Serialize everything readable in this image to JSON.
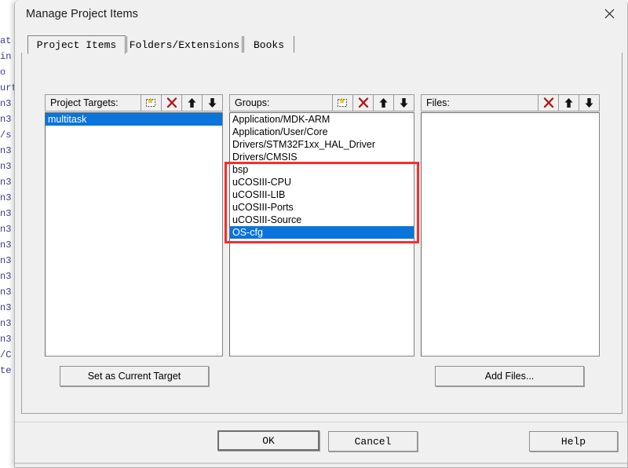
{
  "background": {
    "code_fragment": "at\nin\no\nurt\nn3\nn3\n/s\nn3\nn3\nn3\nn3\nn3\nn3\nn3\nn3\nn3\nn3\nn3\nn3\nn3\n/C\nte"
  },
  "dialog": {
    "title": "Manage Project Items",
    "close_icon": "close-icon"
  },
  "tabs": [
    {
      "label": "Project Items",
      "active": true
    },
    {
      "label": "Folders/Extensions",
      "active": false
    },
    {
      "label": "Books",
      "active": false
    }
  ],
  "columns": {
    "targets": {
      "header": "Project Targets:",
      "buttons": [
        {
          "name": "new-item-button",
          "icon": "new-item-icon"
        },
        {
          "name": "delete-button",
          "icon": "red-x-icon"
        },
        {
          "name": "move-up-button",
          "icon": "arrow-up-icon"
        },
        {
          "name": "move-down-button",
          "icon": "arrow-down-icon"
        }
      ],
      "items": [
        {
          "label": "multitask",
          "selected": true
        }
      ]
    },
    "groups": {
      "header": "Groups:",
      "buttons": [
        {
          "name": "new-item-button",
          "icon": "new-item-icon"
        },
        {
          "name": "delete-button",
          "icon": "red-x-icon"
        },
        {
          "name": "move-up-button",
          "icon": "arrow-up-icon"
        },
        {
          "name": "move-down-button",
          "icon": "arrow-down-icon"
        }
      ],
      "items": [
        {
          "label": "Application/MDK-ARM",
          "selected": false
        },
        {
          "label": "Application/User/Core",
          "selected": false
        },
        {
          "label": "Drivers/STM32F1xx_HAL_Driver",
          "selected": false
        },
        {
          "label": "Drivers/CMSIS",
          "selected": false
        },
        {
          "label": "bsp",
          "selected": false
        },
        {
          "label": "uCOSIII-CPU",
          "selected": false
        },
        {
          "label": "uCOSIII-LIB",
          "selected": false
        },
        {
          "label": "uCOSIII-Ports",
          "selected": false
        },
        {
          "label": "uCOSIII-Source",
          "selected": false
        },
        {
          "label": "OS-cfg",
          "selected": true
        }
      ]
    },
    "files": {
      "header": "Files:",
      "buttons": [
        {
          "name": "delete-button",
          "icon": "red-x-icon"
        },
        {
          "name": "move-up-button",
          "icon": "arrow-up-icon"
        },
        {
          "name": "move-down-button",
          "icon": "arrow-down-icon"
        }
      ],
      "items": []
    }
  },
  "actions": {
    "set_current_target": "Set as Current Target",
    "add_files": "Add Files..."
  },
  "footer": {
    "ok": "OK",
    "cancel": "Cancel",
    "help": "Help"
  },
  "annotation": {
    "color": "#fb2c2c",
    "note": "highlight box around bsp through OS-cfg groups"
  },
  "colors": {
    "selection_blue": "#0a74da",
    "dialog_face": "#f0f0f0",
    "annotation_red": "#fb2c2c"
  }
}
